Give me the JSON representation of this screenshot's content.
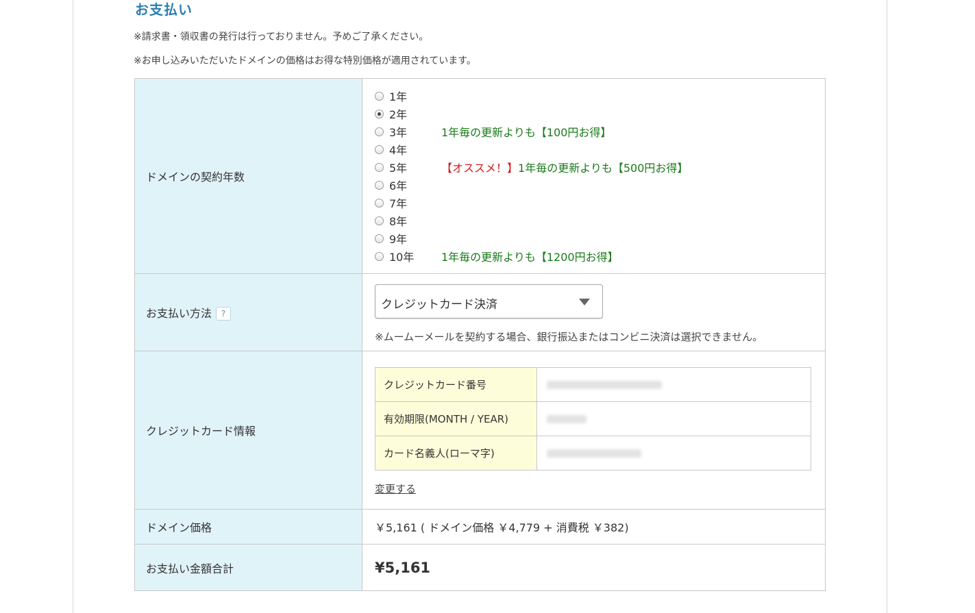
{
  "section": {
    "title": "お支払い",
    "notes": [
      "※請求書・領収書の発行は行っておりません。予めご了承ください。",
      "※お申し込みいただいたドメインの価格はお得な特別価格が適用されています。"
    ]
  },
  "years": {
    "label": "ドメインの契約年数",
    "selected": "2年",
    "options": [
      {
        "label": "1年",
        "checked": false,
        "promo_red": "",
        "promo_green": ""
      },
      {
        "label": "2年",
        "checked": true,
        "promo_red": "",
        "promo_green": ""
      },
      {
        "label": "3年",
        "checked": false,
        "promo_red": "",
        "promo_green": "1年毎の更新よりも【100円お得】"
      },
      {
        "label": "4年",
        "checked": false,
        "promo_red": "",
        "promo_green": ""
      },
      {
        "label": "5年",
        "checked": false,
        "promo_red": "【オススメ！】",
        "promo_green": "1年毎の更新よりも【500円お得】"
      },
      {
        "label": "6年",
        "checked": false,
        "promo_red": "",
        "promo_green": ""
      },
      {
        "label": "7年",
        "checked": false,
        "promo_red": "",
        "promo_green": ""
      },
      {
        "label": "8年",
        "checked": false,
        "promo_red": "",
        "promo_green": ""
      },
      {
        "label": "9年",
        "checked": false,
        "promo_red": "",
        "promo_green": ""
      },
      {
        "label": "10年",
        "checked": false,
        "promo_red": "",
        "promo_green": "1年毎の更新よりも【1200円お得】"
      }
    ]
  },
  "payment_method": {
    "label": "お支払い方法",
    "help": "?",
    "selected": "クレジットカード決済",
    "note": "※ムームーメールを契約する場合、銀行振込またはコンビニ決済は選択できません。"
  },
  "card": {
    "label": "クレジットカード情報",
    "fields": [
      {
        "label": "クレジットカード番号"
      },
      {
        "label": "有効期限(MONTH / YEAR)"
      },
      {
        "label": "カード名義人(ローマ字)"
      }
    ],
    "change_link": "変更する"
  },
  "price": {
    "label": "ドメイン価格",
    "value": "￥5,161 ( ドメイン価格 ￥4,779 + 消費税 ￥382)"
  },
  "total": {
    "label": "お支払い金額合計",
    "value": "¥5,161"
  },
  "colors": {
    "header_bg": "#e0f3f8",
    "card_header_bg": "#fdfdd9",
    "title": "#2b7fb0",
    "promo_green": "#1a7a1a",
    "promo_red": "#d21a1a"
  }
}
